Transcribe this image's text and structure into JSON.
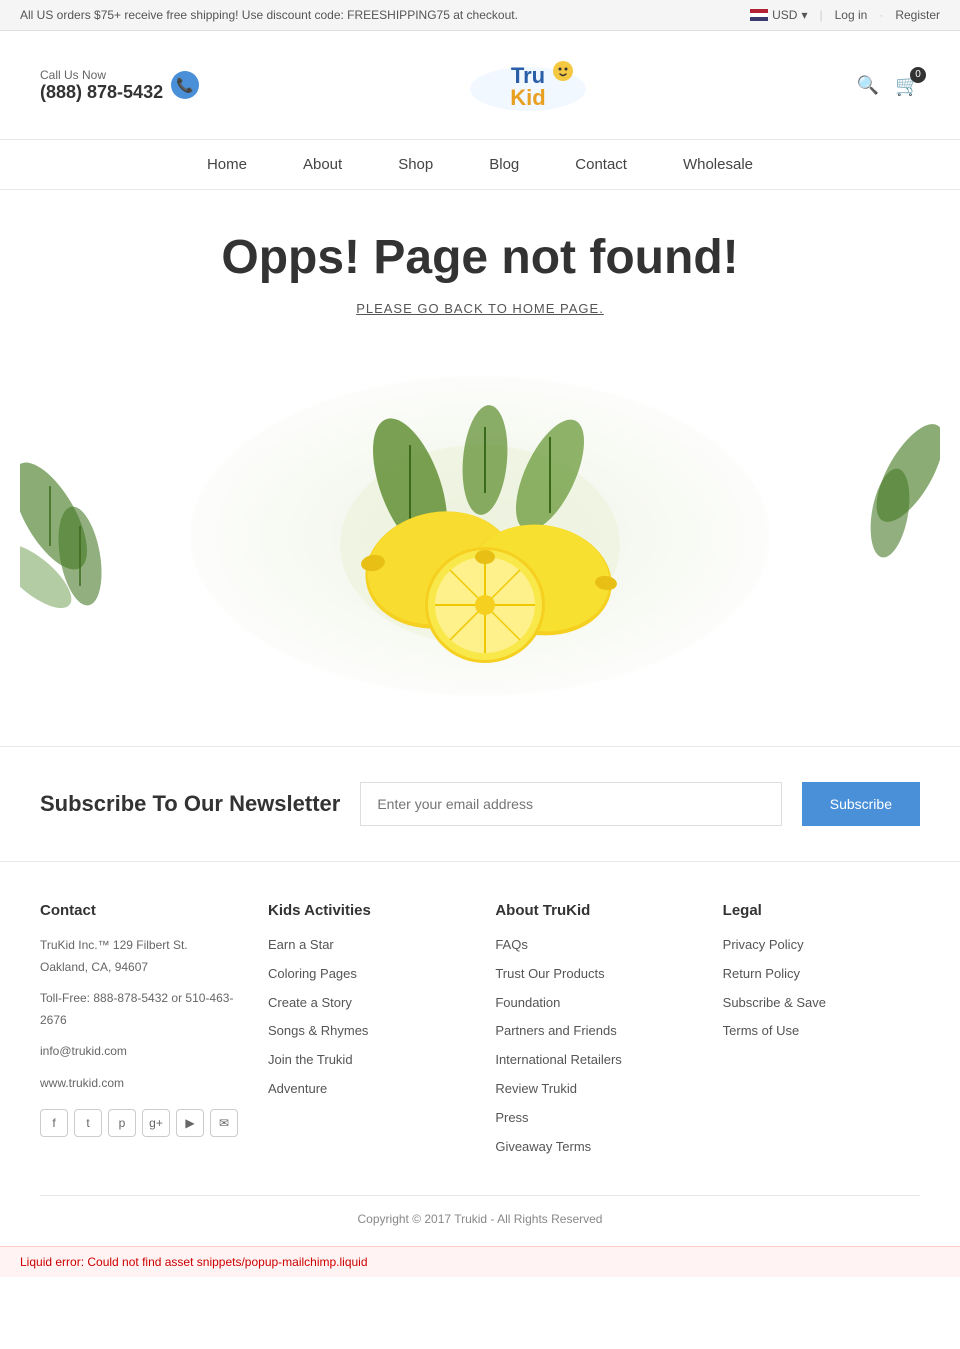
{
  "topbar": {
    "promo_text": "All US orders $75+ receive free shipping! Use discount code: FREESHIPPING75 at checkout.",
    "currency": "USD",
    "login_label": "Log in",
    "register_label": "Register"
  },
  "header": {
    "phone_label": "Call Us Now",
    "phone_number": "(888) 878-5432",
    "logo_alt": "TruKid"
  },
  "nav": {
    "items": [
      {
        "label": "Home",
        "href": "#"
      },
      {
        "label": "About",
        "href": "#"
      },
      {
        "label": "Shop",
        "href": "#"
      },
      {
        "label": "Blog",
        "href": "#"
      },
      {
        "label": "Contact",
        "href": "#"
      },
      {
        "label": "Wholesale",
        "href": "#"
      }
    ]
  },
  "cart": {
    "count": "0"
  },
  "error_page": {
    "title": "Opps! Page not found!",
    "subtitle": "PLEASE GO BACK TO HOME PAGE."
  },
  "newsletter": {
    "title": "Subscribe To Our Newsletter",
    "input_placeholder": "Enter your email address",
    "button_label": "Subscribe"
  },
  "footer": {
    "contact": {
      "title": "Contact",
      "address": "TruKid Inc.™ 129 Filbert St. Oakland, CA, 94607",
      "phone": "Toll-Free: 888-878-5432 or 510-463-2676",
      "email": "info@trukid.com",
      "website": "www.trukid.com"
    },
    "kids_activities": {
      "title": "Kids Activities",
      "links": [
        {
          "label": "Earn a Star",
          "href": "#"
        },
        {
          "label": "Coloring Pages",
          "href": "#"
        },
        {
          "label": "Create a Story",
          "href": "#"
        },
        {
          "label": "Songs & Rhymes",
          "href": "#"
        },
        {
          "label": "Join the Trukid",
          "href": "#"
        },
        {
          "label": "Adventure",
          "href": "#"
        }
      ]
    },
    "about_trukid": {
      "title": "About TruKid",
      "links": [
        {
          "label": "FAQs",
          "href": "#"
        },
        {
          "label": "Trust Our Products",
          "href": "#"
        },
        {
          "label": "Foundation",
          "href": "#"
        },
        {
          "label": "Partners and Friends",
          "href": "#"
        },
        {
          "label": "International Retailers",
          "href": "#"
        },
        {
          "label": "Review Trukid",
          "href": "#"
        },
        {
          "label": "Press",
          "href": "#"
        },
        {
          "label": "Giveaway Terms",
          "href": "#"
        }
      ]
    },
    "legal": {
      "title": "Legal",
      "links": [
        {
          "label": "Privacy Policy",
          "href": "#"
        },
        {
          "label": "Return Policy",
          "href": "#"
        },
        {
          "label": "Subscribe & Save",
          "href": "#"
        },
        {
          "label": "Terms of Use",
          "href": "#"
        }
      ]
    },
    "copyright": "Copyright © 2017 Trukid - All Rights Reserved"
  },
  "liquid_error": {
    "message": "Liquid error: Could not find asset snippets/popup-mailchimp.liquid"
  },
  "social_icons": [
    {
      "name": "facebook",
      "symbol": "f"
    },
    {
      "name": "twitter",
      "symbol": "t"
    },
    {
      "name": "pinterest",
      "symbol": "p"
    },
    {
      "name": "googleplus",
      "symbol": "g+"
    },
    {
      "name": "youtube",
      "symbol": "▶"
    },
    {
      "name": "email",
      "symbol": "✉"
    }
  ]
}
